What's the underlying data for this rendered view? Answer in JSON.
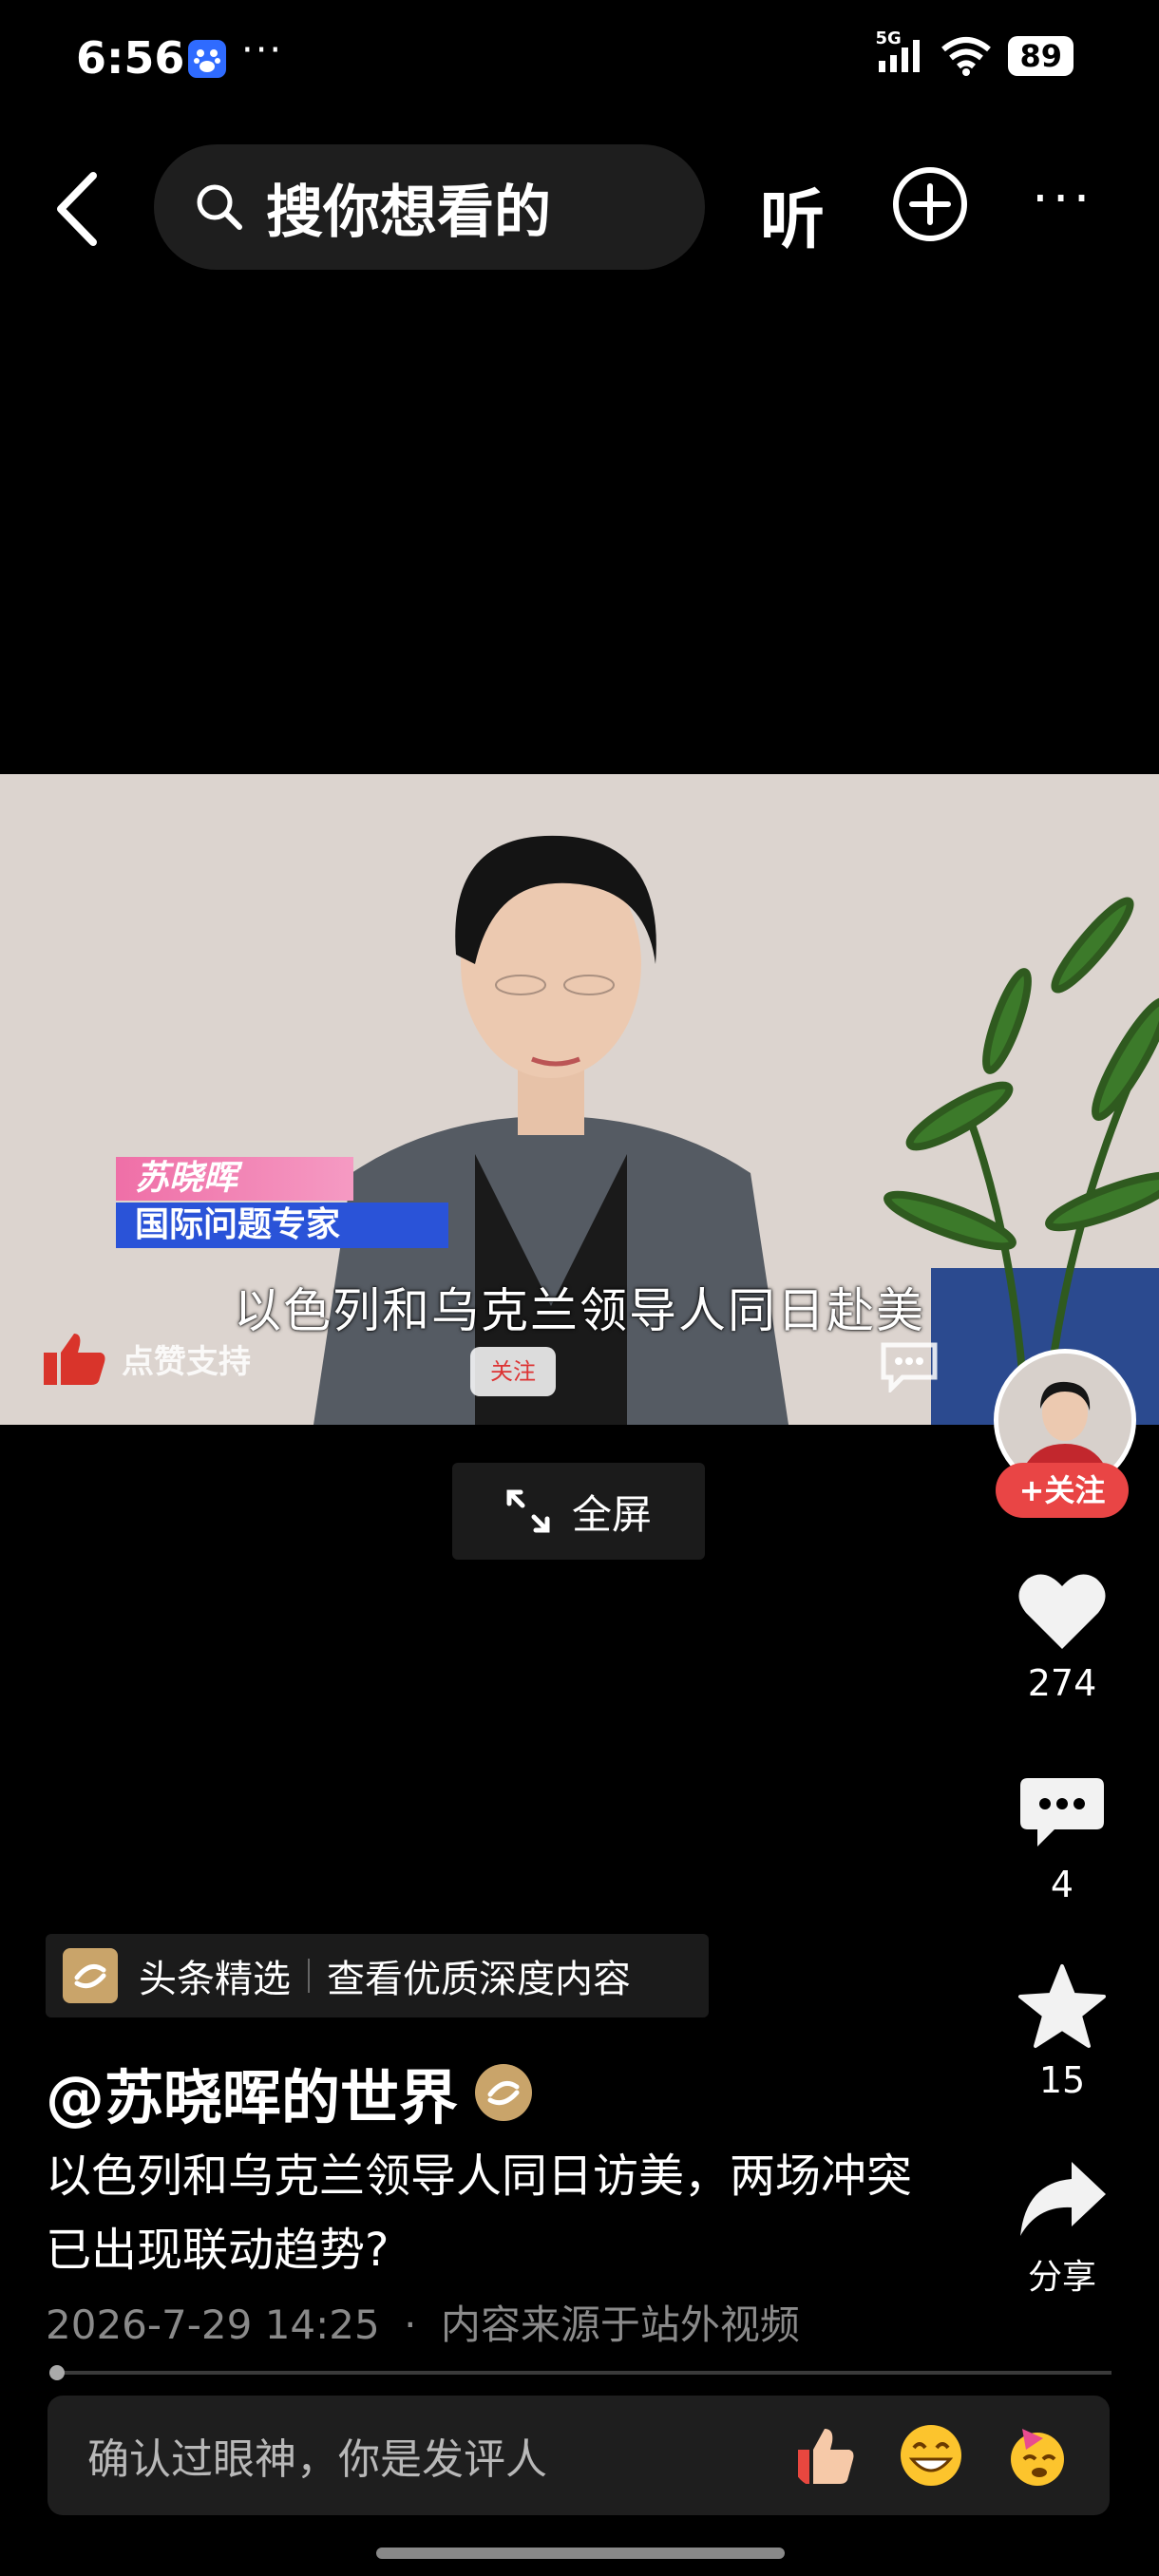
{
  "status_bar": {
    "time": "6:56",
    "more": "···",
    "signal_label": "5G",
    "battery": "89"
  },
  "top_bar": {
    "search_placeholder": "搜你想看的",
    "listen_label": "听",
    "more_label": "···"
  },
  "video": {
    "name_tag": "苏晓晖",
    "title_tag": "国际问题专家",
    "subtitle": "以色列和乌克兰领导人同日赴美",
    "like_support": "点赞支持",
    "follow_small": "关注"
  },
  "fullscreen_label": "全屏",
  "right_rail": {
    "follow_label": "+关注",
    "likes": "274",
    "comments": "4",
    "favorites": "15",
    "share_label": "分享"
  },
  "banner": {
    "name": "头条精选",
    "tagline": "查看优质深度内容"
  },
  "post": {
    "author": "@苏晓晖的世界",
    "description": "以色列和乌克兰领导人同日访美，两场冲突已出现联动趋势?",
    "date": "2026-7-29 14:25",
    "source": "内容来源于站外视频",
    "meta_sep": "·"
  },
  "progress": {
    "fraction": 0.01
  },
  "comment_bar": {
    "placeholder": "确认过眼神，你是发评人"
  }
}
